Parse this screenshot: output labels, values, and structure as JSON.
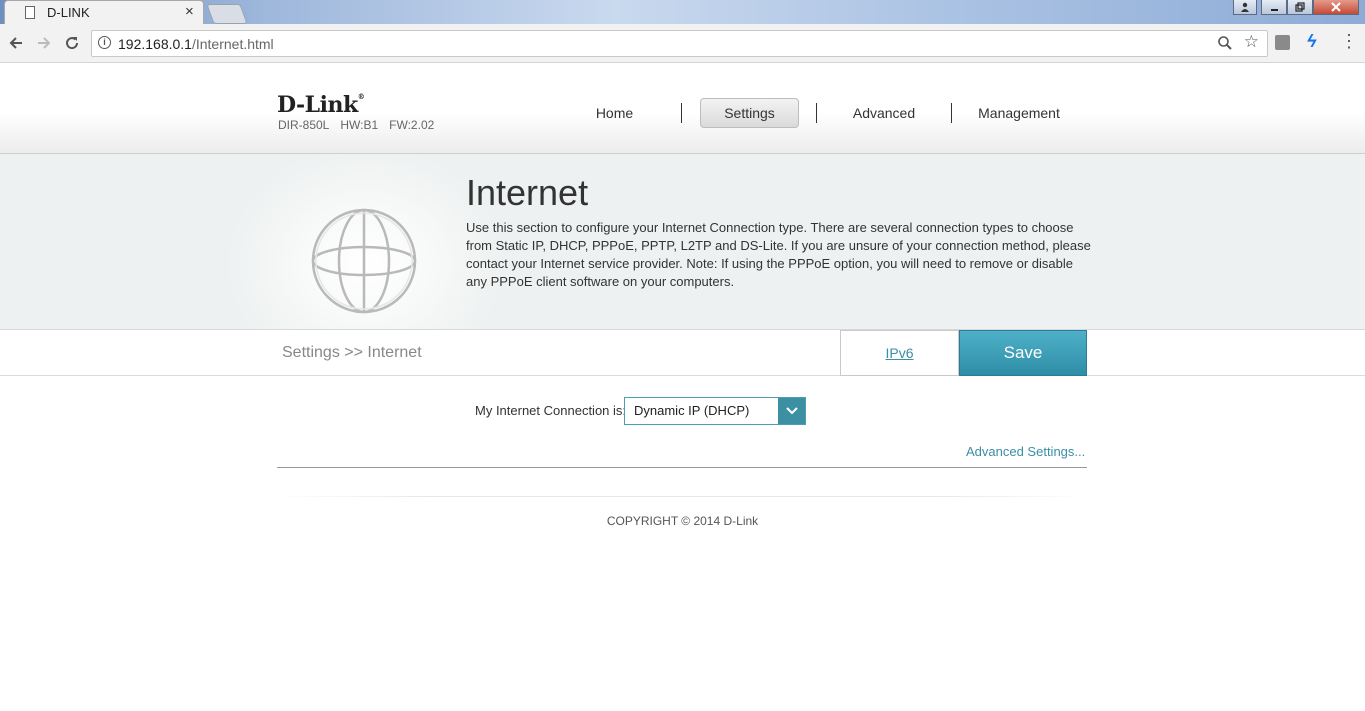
{
  "browser": {
    "tab_title": "D-LINK",
    "tab_close": "×",
    "url_host": "192.168.0.1",
    "url_path": "/Internet.html"
  },
  "header": {
    "logo": "D-Link",
    "model": "DIR-850L",
    "hw": "HW:B1",
    "fw": "FW:2.02",
    "nav": {
      "home": "Home",
      "settings": "Settings",
      "advanced": "Advanced",
      "management": "Management",
      "active": "settings"
    }
  },
  "hero": {
    "title": "Internet",
    "description": "Use this section to configure your Internet Connection type. There are several connection types to choose from Static IP, DHCP, PPPoE, PPTP, L2TP and DS-Lite. If you are unsure of your connection method, please contact your Internet service provider. Note: If using the PPPoE option, you will need to remove or disable any PPPoE client software on your computers."
  },
  "breadcrumb": "Settings >> Internet",
  "actions": {
    "ipv6": "IPv6",
    "save": "Save"
  },
  "form": {
    "connection_label": "My Internet Connection is:",
    "connection_value": "Dynamic IP (DHCP)",
    "advanced_link": "Advanced Settings..."
  },
  "footer": {
    "copyright": "COPYRIGHT © 2014 D-Link"
  },
  "colors": {
    "accent": "#3d8fa4",
    "save_button": "#3a9cb5"
  }
}
